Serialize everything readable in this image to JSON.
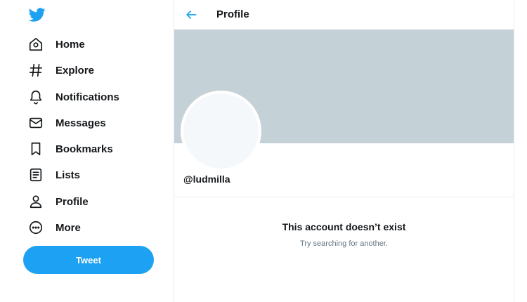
{
  "sidebar": {
    "logo": "twitter-bird-icon",
    "items": [
      {
        "label": "Home",
        "icon": "home-icon"
      },
      {
        "label": "Explore",
        "icon": "hashtag-icon"
      },
      {
        "label": "Notifications",
        "icon": "bell-icon"
      },
      {
        "label": "Messages",
        "icon": "envelope-icon"
      },
      {
        "label": "Bookmarks",
        "icon": "bookmark-icon"
      },
      {
        "label": "Lists",
        "icon": "list-icon"
      },
      {
        "label": "Profile",
        "icon": "person-icon"
      },
      {
        "label": "More",
        "icon": "more-circle-icon"
      }
    ],
    "tweet_label": "Tweet"
  },
  "header": {
    "title": "Profile",
    "back_icon": "back-arrow-icon"
  },
  "profile": {
    "handle": "@ludmilla"
  },
  "empty_state": {
    "title": "This account doesn’t exist",
    "subtitle": "Try searching for another."
  },
  "colors": {
    "accent": "#1da1f2",
    "banner": "#c4d1d6",
    "text": "#14171a",
    "muted": "#657786",
    "border": "#e6ecf0"
  }
}
